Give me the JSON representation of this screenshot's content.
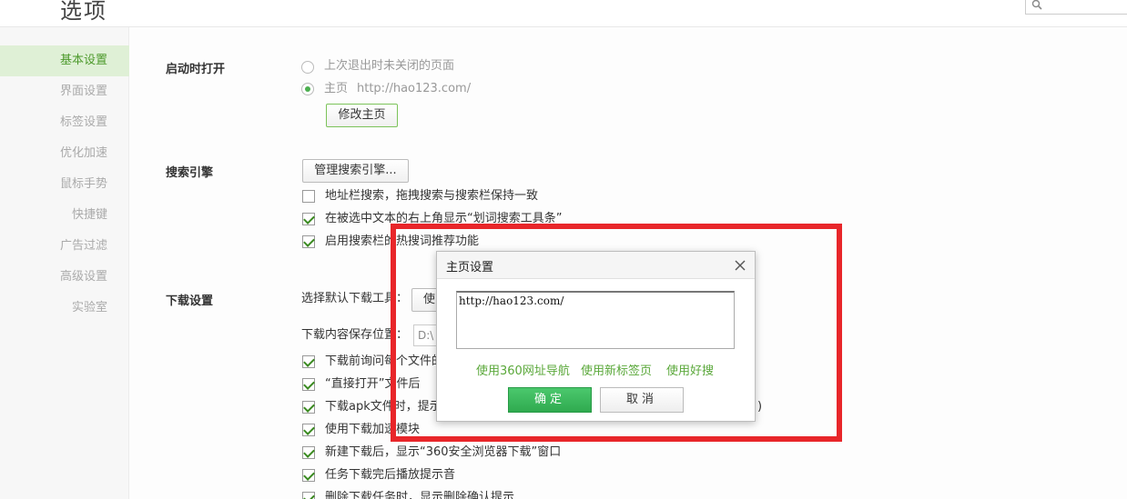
{
  "header": {
    "title": "选项",
    "search_placeholder": "",
    "search_icon": "search-icon"
  },
  "sidebar": {
    "items": [
      {
        "label": "基本设置",
        "active": true
      },
      {
        "label": "界面设置"
      },
      {
        "label": "标签设置"
      },
      {
        "label": "优化加速"
      },
      {
        "label": "鼠标手势"
      },
      {
        "label": "快捷键"
      },
      {
        "label": "广告过滤"
      },
      {
        "label": "高级设置"
      },
      {
        "label": "实验室"
      }
    ]
  },
  "startup": {
    "label": "启动时打开",
    "option_last": "上次退出时未关闭的页面",
    "option_home": "主页",
    "home_url": "http://hao123.com/",
    "modify_button": "修改主页"
  },
  "search": {
    "label": "搜索引擎",
    "manage_button": "管理搜索引擎...",
    "opt1": "地址栏搜索，拖拽搜索与搜索栏保持一致",
    "opt2": "在被选中文本的右上角显示“划词搜索工具条”",
    "opt3": "启用搜索栏的热搜词推荐功能"
  },
  "download": {
    "label": "下载设置",
    "tool_label": "选择默认下载工具：",
    "tool_value": "使",
    "path_label": "下载内容保存位置：",
    "path_value": "D:\\",
    "opt1": "下载前询问每个文件的",
    "opt2": "“直接打开”文件后",
    "opt3": "下载apk文件时，提示",
    "opt3_tail": ")",
    "opt4": "使用下载加速模块",
    "opt5": "新建下载后，显示“360安全浏览器下载”窗口",
    "opt6": "任务下载完后播放提示音",
    "opt7": "删除下载任务时，显示删除确认提示"
  },
  "dialog": {
    "title": "主页设置",
    "url_value": "http://hao123.com/",
    "link1": "使用360网址导航",
    "link2": "使用新标签页",
    "link3": "使用好搜",
    "ok": "确定",
    "cancel": "取消"
  },
  "colors": {
    "accent": "#4caf50",
    "highlight": "#e8262a",
    "active_bg": "#dff0d6"
  }
}
